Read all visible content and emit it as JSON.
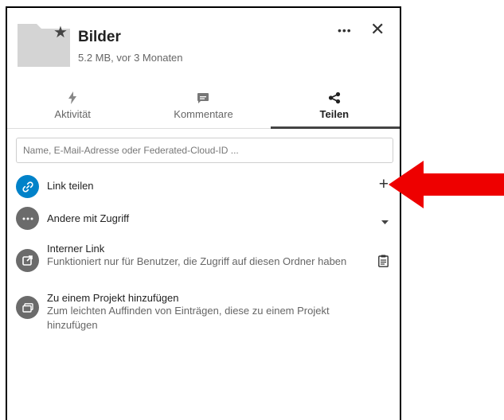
{
  "file": {
    "title": "Bilder",
    "meta": "5.2 MB, vor 3 Monaten",
    "folder_color": "#d4d4d4"
  },
  "header": {
    "more_label": "•••",
    "close_label": "✕"
  },
  "tabs": [
    {
      "label": "Aktivität",
      "icon": "activity-icon"
    },
    {
      "label": "Kommentare",
      "icon": "comment-icon"
    },
    {
      "label": "Teilen",
      "icon": "share-icon",
      "active": true
    }
  ],
  "search": {
    "placeholder": "Name, E-Mail-Adresse oder Federated-Cloud-ID ..."
  },
  "share_link": {
    "label": "Link teilen",
    "action": "+",
    "avatar_color": "#0082c9"
  },
  "others": {
    "label": "Andere mit Zugriff",
    "avatar_color": "#6b6b6b"
  },
  "internal_link": {
    "title": "Interner Link",
    "description": "Funktioniert nur für Benutzer, die Zugriff auf diesen Ordner haben"
  },
  "project": {
    "title": "Zu einem Projekt hinzufügen",
    "description": "Zum leichten Auffinden von Einträgen, diese zu einem Projekt hinzufügen"
  },
  "annotation": {
    "arrow_color": "#ee0000"
  }
}
